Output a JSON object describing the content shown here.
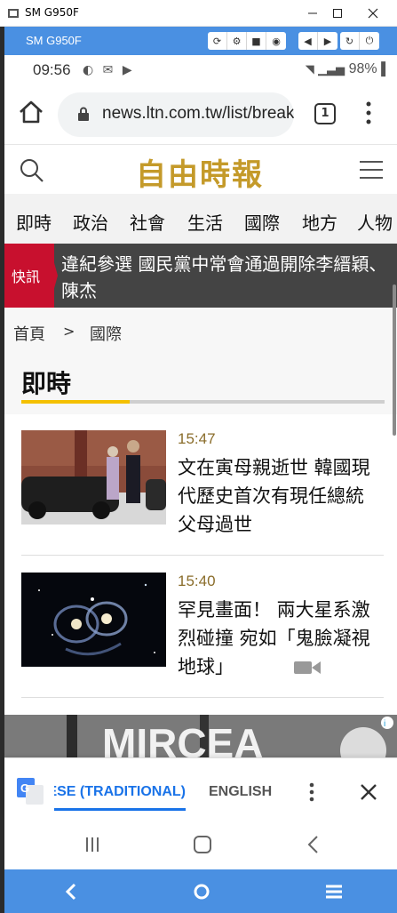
{
  "window": {
    "title": "SM G950F",
    "minimize_icon": "minimize-icon",
    "maximize_icon": "maximize-icon",
    "close_icon": "close-icon"
  },
  "toolbar": {
    "device_name": "SM G950F",
    "icons": [
      "rotate-icon",
      "settings-icon",
      "video-icon",
      "camera-icon",
      "volume-down-icon",
      "volume-up-icon",
      "refresh-icon",
      "power-icon"
    ]
  },
  "status_bar": {
    "time": "09:56",
    "left_icons": [
      "notification-icon",
      "mail-icon",
      "app-icon"
    ],
    "battery": "98%"
  },
  "browser": {
    "url": "news.ltn.com.tw/list/breakingnews/world",
    "tab_count": "1"
  },
  "site": {
    "logo": "自由時報"
  },
  "categories": [
    "即時",
    "政治",
    "社會",
    "生活",
    "國際",
    "地方",
    "人物"
  ],
  "ticker": {
    "tag": "快訊",
    "headline": "違紀參選 國民黨中常會通過開除李縉穎、陳杰"
  },
  "breadcrumb": {
    "home": "首頁",
    "separator": ">",
    "current": "國際"
  },
  "section": {
    "title": "即時"
  },
  "articles": [
    {
      "time": "15:47",
      "title": "文在寅母親逝世 韓國現代歷史首次有現任總統父母過世",
      "has_video": false
    },
    {
      "time": "15:40",
      "title": "罕見畫面！ 兩大星系激烈碰撞 宛如「鬼臉凝視地球」",
      "has_video": true
    }
  ],
  "translate_bar": {
    "source_lang": "CHINESE (TRADITIONAL)",
    "target_lang": "ENGLISH"
  },
  "colors": {
    "toolbar_blue": "#4a90e2",
    "logo_gold": "#c49a2a",
    "ticker_red": "#c8102e",
    "accent_yellow": "#f4c000",
    "time_brown": "#8a6d2b",
    "translate_blue": "#1a73e8"
  }
}
